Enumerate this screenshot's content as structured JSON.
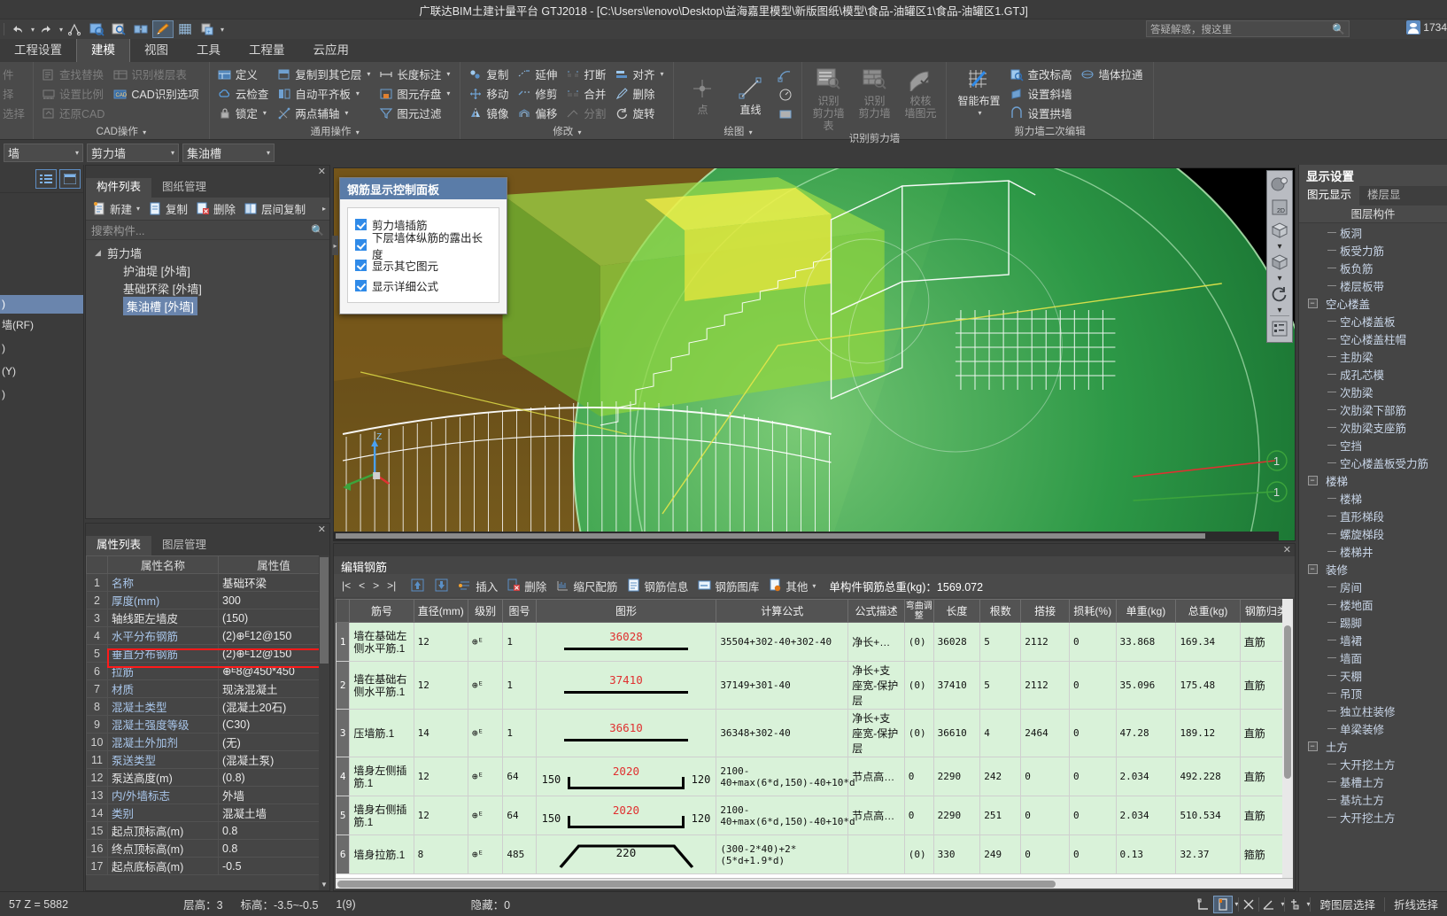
{
  "titlebar": {
    "title": "广联达BIM土建计量平台 GTJ2018 - [C:\\Users\\lenovo\\Desktop\\益海嘉里模型\\新版图纸\\模型\\食品-油罐区1\\食品-油罐区1.GTJ]"
  },
  "quick_access": {
    "search_placeholder": "答疑解惑，搜这里",
    "user_label": "1734",
    "icons": [
      "undo-icon",
      "redo-icon",
      "cad-icon",
      "image-search-icon",
      "zoom-doc-icon",
      "layers-icon",
      "pencil-icon",
      "grid-icon",
      "export-icon",
      "more-icon"
    ]
  },
  "ribbon": {
    "tabs": [
      {
        "label": "工程设置",
        "active": false
      },
      {
        "label": "建模",
        "active": true
      },
      {
        "label": "视图",
        "active": false
      },
      {
        "label": "工具",
        "active": false
      },
      {
        "label": "工程量",
        "active": false
      },
      {
        "label": "云应用",
        "active": false
      }
    ],
    "groups": [
      {
        "name": "选择",
        "label": "",
        "items": [
          {
            "label": "件",
            "disabled": true
          },
          {
            "label": "择",
            "disabled": true
          },
          {
            "label": "选择",
            "disabled": true
          }
        ]
      },
      {
        "name": "CAD操作",
        "label": "CAD操作",
        "columns": [
          [
            {
              "label": "查找替换",
              "icon": "find-replace-icon",
              "disabled": true
            },
            {
              "label": "设置比例",
              "icon": "scale-icon",
              "disabled": true
            },
            {
              "label": "还原CAD",
              "icon": "restore-cad-icon",
              "disabled": true
            }
          ],
          [
            {
              "label": "识别楼层表",
              "icon": "floor-table-icon",
              "disabled": true
            },
            {
              "label": "CAD识别选项",
              "icon": "cad-options-icon",
              "disabled": false
            }
          ]
        ]
      },
      {
        "name": "通用操作",
        "label": "通用操作",
        "columns": [
          [
            {
              "label": "定义",
              "icon": "define-icon"
            },
            {
              "label": "云检查",
              "icon": "cloud-check-icon"
            },
            {
              "label": "锁定",
              "icon": "lock-icon",
              "caret": true
            }
          ],
          [
            {
              "label": "复制到其它层",
              "icon": "copy-layer-icon",
              "caret": true
            },
            {
              "label": "自动平齐板",
              "icon": "align-slab-icon",
              "caret": true
            },
            {
              "label": "两点辅轴",
              "icon": "two-point-axis-icon",
              "caret": true
            }
          ],
          [
            {
              "label": "长度标注",
              "icon": "length-dim-icon",
              "caret": true
            },
            {
              "label": "图元存盘",
              "icon": "save-element-icon",
              "caret": true
            },
            {
              "label": "图元过滤",
              "icon": "filter-element-icon"
            }
          ]
        ]
      },
      {
        "name": "修改",
        "label": "修改",
        "columns": [
          [
            {
              "label": "复制",
              "icon": "copy-icon"
            },
            {
              "label": "移动",
              "icon": "move-icon"
            },
            {
              "label": "镜像",
              "icon": "mirror-icon"
            }
          ],
          [
            {
              "label": "延伸",
              "icon": "extend-icon"
            },
            {
              "label": "修剪",
              "icon": "trim-icon"
            },
            {
              "label": "偏移",
              "icon": "offset-icon"
            }
          ],
          [
            {
              "label": "打断",
              "icon": "break-icon"
            },
            {
              "label": "合并",
              "icon": "merge-icon"
            },
            {
              "label": "分割",
              "icon": "split-icon",
              "disabled": true
            }
          ],
          [
            {
              "label": "对齐",
              "icon": "align-icon",
              "caret": true
            },
            {
              "label": "删除",
              "icon": "delete-icon"
            },
            {
              "label": "旋转",
              "icon": "rotate-icon"
            }
          ]
        ]
      },
      {
        "name": "绘图",
        "label": "绘图",
        "big_items": [
          {
            "label": "点",
            "icon": "point-icon",
            "disabled": true
          },
          {
            "label": "直线",
            "icon": "line-icon"
          }
        ],
        "small_icons": [
          "arc-icon",
          "circle-icon",
          "rect-icon"
        ]
      },
      {
        "name": "识别剪力墙",
        "label": "识别剪力墙",
        "big_items": [
          {
            "label": "识别\n剪力墙表",
            "icon": "identify-wall-table-icon",
            "disabled": true
          },
          {
            "label": "识别\n剪力墙",
            "icon": "identify-wall-icon",
            "disabled": true
          },
          {
            "label": "校核\n墙图元",
            "icon": "check-wall-icon",
            "disabled": true
          }
        ]
      },
      {
        "name": "剪力墙二次编辑",
        "label": "剪力墙二次编辑",
        "big_items": [
          {
            "label": "智能布置",
            "icon": "smart-layout-icon",
            "caret": true
          }
        ],
        "columns": [
          [
            {
              "label": "查改标高",
              "icon": "check-elev-icon"
            },
            {
              "label": "设置斜墙",
              "icon": "slope-wall-icon"
            },
            {
              "label": "设置拱墙",
              "icon": "arch-wall-icon"
            }
          ],
          [
            {
              "label": "墙体拉通",
              "icon": "wall-through-icon"
            }
          ]
        ]
      }
    ]
  },
  "combobar": {
    "combos": [
      {
        "value": "墙",
        "name": "category-combo"
      },
      {
        "value": "剪力墙",
        "name": "element-combo"
      },
      {
        "value": "集油槽",
        "name": "component-combo"
      }
    ]
  },
  "left_panel": {
    "view_buttons": [
      "list-view-icon",
      "detail-view-icon"
    ],
    "cut_list": [
      {
        "label": ")",
        "selected": true
      },
      {
        "label": "墙(RF)",
        "selected": false
      },
      {
        "label": ")",
        "selected": false
      },
      {
        "label": "(Y)",
        "selected": false
      },
      {
        "label": ")",
        "selected": false
      }
    ],
    "tabs": [
      {
        "label": "构件列表",
        "active": true
      },
      {
        "label": "图纸管理",
        "active": false
      }
    ],
    "toolbar": [
      {
        "label": "新建",
        "icon": "new-icon",
        "caret": true
      },
      {
        "label": "复制",
        "icon": "copy-icon"
      },
      {
        "label": "删除",
        "icon": "delete-icon"
      },
      {
        "label": "层间复制",
        "icon": "layer-copy-icon"
      }
    ],
    "search_placeholder": "搜索构件...",
    "tree": {
      "root": "剪力墙",
      "children": [
        {
          "label": "护油堤 [外墙]",
          "selected": false
        },
        {
          "label": "基础环梁 [外墙]",
          "selected": false
        },
        {
          "label": "集油槽 [外墙]",
          "selected": true
        }
      ]
    }
  },
  "properties": {
    "tabs": [
      {
        "label": "属性列表",
        "active": true
      },
      {
        "label": "图层管理",
        "active": false
      }
    ],
    "headers": [
      "属性名称",
      "属性值"
    ],
    "highlight_row": 4,
    "rows": [
      {
        "n": "1",
        "name": "名称",
        "value": "基础环梁",
        "blue": true
      },
      {
        "n": "2",
        "name": "厚度(mm)",
        "value": "300",
        "blue": true
      },
      {
        "n": "3",
        "name": "轴线距左墙皮",
        "value": "(150)",
        "blue": false
      },
      {
        "n": "4",
        "name": "水平分布钢筋",
        "value": "(2)⊕ᴱ12@150",
        "blue": true
      },
      {
        "n": "5",
        "name": "垂直分布钢筋",
        "value": "(2)⊕ᴱ12@150",
        "blue": true
      },
      {
        "n": "6",
        "name": "拉筋",
        "value": "⊕ᴱ8@450*450",
        "blue": true
      },
      {
        "n": "7",
        "name": "材质",
        "value": "现浇混凝土",
        "blue": true
      },
      {
        "n": "8",
        "name": "混凝土类型",
        "value": "(混凝土20石)",
        "blue": true
      },
      {
        "n": "9",
        "name": "混凝土强度等级",
        "value": "(C30)",
        "blue": true
      },
      {
        "n": "10",
        "name": "混凝土外加剂",
        "value": "(无)",
        "blue": true
      },
      {
        "n": "11",
        "name": "泵送类型",
        "value": "(混凝土泵)",
        "blue": true
      },
      {
        "n": "12",
        "name": "泵送高度(m)",
        "value": "(0.8)",
        "blue": false
      },
      {
        "n": "13",
        "name": "内/外墙标志",
        "value": "外墙",
        "blue": true
      },
      {
        "n": "14",
        "name": "类别",
        "value": "混凝土墙",
        "blue": true
      },
      {
        "n": "15",
        "name": "起点顶标高(m)",
        "value": "0.8",
        "blue": false
      },
      {
        "n": "16",
        "name": "终点顶标高(m)",
        "value": "0.8",
        "blue": false
      },
      {
        "n": "17",
        "name": "起点底标高(m)",
        "value": "-0.5",
        "blue": false
      }
    ]
  },
  "rebar_dialog": {
    "title": "钢筋显示控制面板",
    "options": [
      {
        "label": "剪力墙插筋",
        "checked": true
      },
      {
        "label": "下层墙体纵筋的露出长度",
        "checked": true
      },
      {
        "label": "显示其它图元",
        "checked": true
      },
      {
        "label": "显示详细公式",
        "checked": true
      }
    ]
  },
  "viewport": {
    "navcube_icons": [
      "orbit-icon",
      "2d-icon",
      "box-top-icon",
      "box-icon",
      "rotate-icon",
      "settings-icon"
    ],
    "axis_labels": [
      "Z",
      "X",
      "Y"
    ],
    "markers": [
      "1",
      "1"
    ]
  },
  "rebar_panel": {
    "title": "编辑钢筋",
    "nav_buttons": [
      "|<",
      "<",
      ">",
      ">|"
    ],
    "toolbar": [
      {
        "label": "",
        "icon": "move-up-icon"
      },
      {
        "label": "",
        "icon": "move-down-icon"
      },
      {
        "label": "插入",
        "icon": "insert-icon"
      },
      {
        "label": "删除",
        "icon": "delete-icon"
      },
      {
        "label": "缩尺配筋",
        "icon": "scale-rebar-icon"
      },
      {
        "label": "钢筋信息",
        "icon": "rebar-info-icon"
      },
      {
        "label": "钢筋图库",
        "icon": "rebar-library-icon"
      },
      {
        "label": "其他",
        "icon": "other-icon",
        "caret": true
      }
    ],
    "total_label": "单构件钢筋总重(kg)：1569.072",
    "columns": [
      "筋号",
      "直径(mm)",
      "级别",
      "图号",
      "图形",
      "计算公式",
      "公式描述",
      "弯曲调整",
      "长度",
      "根数",
      "搭接",
      "损耗(%)",
      "单重(kg)",
      "总重(kg)",
      "钢筋归类"
    ],
    "rows": [
      {
        "no": "1",
        "name": "墙在基础左侧水平筋.1",
        "dia": "12",
        "grade": "⊕ᴱ",
        "fig": "1",
        "shape_type": "straight",
        "shape_label": "36028",
        "shape_left": "",
        "shape_right": "",
        "formula": "35504+302-40+302-40",
        "desc": "净长+…",
        "bend": "(0)",
        "len": "36028",
        "count": "5",
        "lap": "2112",
        "loss": "0",
        "unit_w": "33.868",
        "total_w": "169.34",
        "cat": "直筋"
      },
      {
        "no": "2",
        "name": "墙在基础右侧水平筋.1",
        "dia": "12",
        "grade": "⊕ᴱ",
        "fig": "1",
        "shape_type": "straight",
        "shape_label": "37410",
        "shape_left": "",
        "shape_right": "",
        "formula": "37149+301-40",
        "desc": "净长+支座宽-保护层",
        "bend": "(0)",
        "len": "37410",
        "count": "5",
        "lap": "2112",
        "loss": "0",
        "unit_w": "35.096",
        "total_w": "175.48",
        "cat": "直筋"
      },
      {
        "no": "3",
        "name": "压墙筋.1",
        "dia": "14",
        "grade": "⊕ᴱ",
        "fig": "1",
        "shape_type": "straight",
        "shape_label": "36610",
        "shape_left": "",
        "shape_right": "",
        "formula": "36348+302-40",
        "desc": "净长+支座宽-保护层",
        "bend": "(0)",
        "len": "36610",
        "count": "4",
        "lap": "2464",
        "loss": "0",
        "unit_w": "47.28",
        "total_w": "189.12",
        "cat": "直筋"
      },
      {
        "no": "4",
        "name": "墙身左侧插筋.1",
        "dia": "12",
        "grade": "⊕ᴱ",
        "fig": "64",
        "shape_type": "u",
        "shape_label": "2020",
        "shape_left": "150",
        "shape_right": "120",
        "formula": "2100-40+max(6*d,150)-40+10*d",
        "desc": "节点高…",
        "bend": "0",
        "len": "2290",
        "count": "242",
        "lap": "0",
        "loss": "0",
        "unit_w": "2.034",
        "total_w": "492.228",
        "cat": "直筋"
      },
      {
        "no": "5",
        "name": "墙身右侧插筋.1",
        "dia": "12",
        "grade": "⊕ᴱ",
        "fig": "64",
        "shape_type": "u",
        "shape_label": "2020",
        "shape_left": "150",
        "shape_right": "120",
        "formula": "2100-40+max(6*d,150)-40+10*d",
        "desc": "节点高…",
        "bend": "0",
        "len": "2290",
        "count": "251",
        "lap": "0",
        "loss": "0",
        "unit_w": "2.034",
        "total_w": "510.534",
        "cat": "直筋"
      },
      {
        "no": "6",
        "name": "墙身拉筋.1",
        "dia": "8",
        "grade": "⊕ᴱ",
        "fig": "485",
        "shape_type": "tie",
        "shape_label": "220",
        "shape_left": "",
        "shape_right": "",
        "formula": "(300-2*40)+2*(5*d+1.9*d)",
        "desc": "",
        "bend": "(0)",
        "len": "330",
        "count": "249",
        "lap": "0",
        "loss": "0",
        "unit_w": "0.13",
        "total_w": "32.37",
        "cat": "箍筋"
      }
    ]
  },
  "right_panel": {
    "title": "显示设置",
    "tabs": [
      {
        "label": "图元显示",
        "active": true
      },
      {
        "label": "楼层显",
        "active": false
      }
    ],
    "column_header": "图层构件",
    "tree": [
      {
        "label": "板洞",
        "level": 1
      },
      {
        "label": "板受力筋",
        "level": 1
      },
      {
        "label": "板负筋",
        "level": 1
      },
      {
        "label": "楼层板带",
        "level": 1
      },
      {
        "label": "空心楼盖",
        "level": 0
      },
      {
        "label": "空心楼盖板",
        "level": 1
      },
      {
        "label": "空心楼盖柱帽",
        "level": 1
      },
      {
        "label": "主肋梁",
        "level": 1
      },
      {
        "label": "成孔芯模",
        "level": 1
      },
      {
        "label": "次肋梁",
        "level": 1
      },
      {
        "label": "次肋梁下部筋",
        "level": 1
      },
      {
        "label": "次肋梁支座筋",
        "level": 1
      },
      {
        "label": "空挡",
        "level": 1
      },
      {
        "label": "空心楼盖板受力筋",
        "level": 1
      },
      {
        "label": "楼梯",
        "level": 0
      },
      {
        "label": "楼梯",
        "level": 1
      },
      {
        "label": "直形梯段",
        "level": 1
      },
      {
        "label": "螺旋梯段",
        "level": 1
      },
      {
        "label": "楼梯井",
        "level": 1
      },
      {
        "label": "装修",
        "level": 0
      },
      {
        "label": "房间",
        "level": 1
      },
      {
        "label": "楼地面",
        "level": 1
      },
      {
        "label": "踢脚",
        "level": 1
      },
      {
        "label": "墙裙",
        "level": 1
      },
      {
        "label": "墙面",
        "level": 1
      },
      {
        "label": "天棚",
        "level": 1
      },
      {
        "label": "吊顶",
        "level": 1
      },
      {
        "label": "独立柱装修",
        "level": 1
      },
      {
        "label": "单梁装修",
        "level": 1
      },
      {
        "label": "土方",
        "level": 0
      },
      {
        "label": "大开挖土方",
        "level": 1
      },
      {
        "label": "基槽土方",
        "level": 1
      },
      {
        "label": "基坑土方",
        "level": 1
      },
      {
        "label": "大开挖土方",
        "level": 1
      }
    ]
  },
  "status_bar": {
    "coord": "57 Z = 5882",
    "floor_height": "层高：3",
    "elevation": "标高：-3.5~-0.5",
    "count": "1(9)",
    "hidden": "隐藏：0",
    "icons": [
      "snap-icon",
      "ortho-icon",
      "cross-icon",
      "angle-icon",
      "add-icon"
    ],
    "buttons": [
      "跨图层选择",
      "折线选择"
    ]
  }
}
